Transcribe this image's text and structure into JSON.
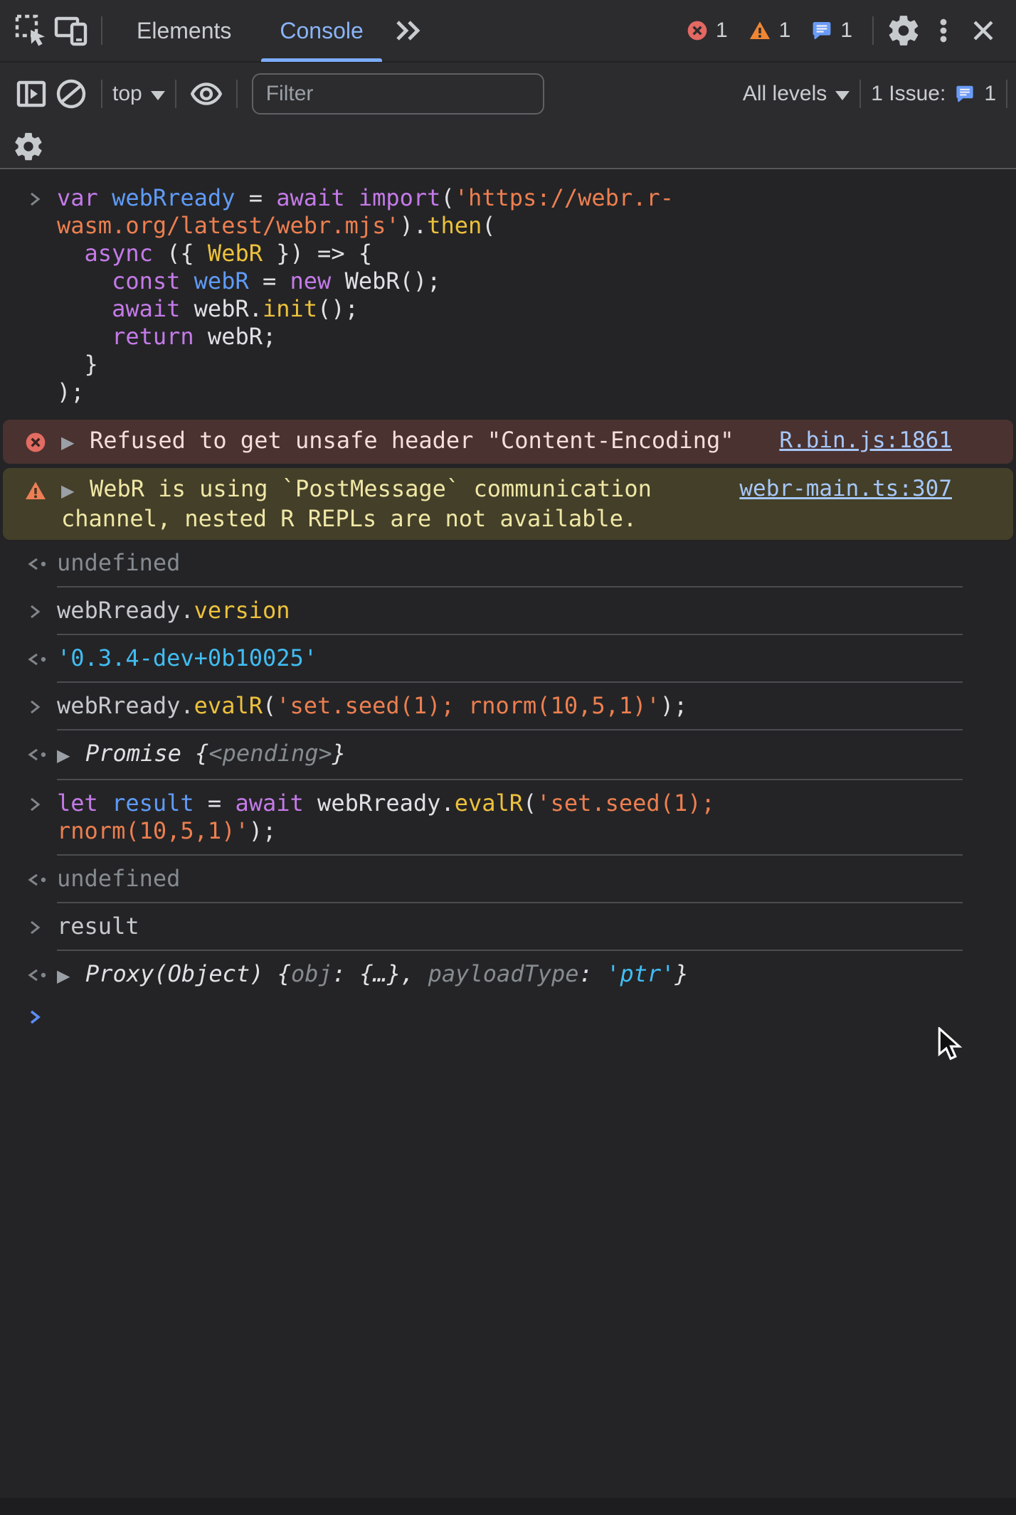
{
  "tabbar": {
    "tabs": [
      {
        "label": "Elements",
        "active": false
      },
      {
        "label": "Console",
        "active": true
      }
    ],
    "badges": {
      "errors": "1",
      "warnings": "1",
      "messages": "1"
    }
  },
  "toolbar": {
    "context_selector": "top",
    "filter_placeholder": "Filter",
    "levels_label": "All levels",
    "issues_label": "1 Issue:",
    "issues_count": "1"
  },
  "icons": {
    "tabbar": [
      "inspect-icon",
      "device-toolbar-icon",
      "more-tabs-icon",
      "error-badge-icon",
      "warning-badge-icon",
      "messages-badge-icon",
      "settings-gear-icon",
      "kebab-menu-icon",
      "close-icon"
    ],
    "toolbar": [
      "sidebar-toggle-icon",
      "clear-console-icon",
      "chevron-down-icon",
      "eye-icon",
      "filter-input",
      "issues-bubble-icon",
      "console-settings-gear-icon"
    ]
  },
  "colors": {
    "accent": "#8ab4f8",
    "tab_underline": "#7cacf8",
    "error_bg": "#4a3230",
    "warning_bg": "#443f28",
    "error_icon": "#e36c62",
    "warning_icon": "#ed7e56",
    "link": "#a6c7fa",
    "keyword": "#c47ae8",
    "variable": "#5f9bf7",
    "function": "#edc13c",
    "string": "#ed7f50",
    "string_value": "#41bdf3",
    "dim": "#868b90",
    "text": "#dfe1e4",
    "prompt": "#5e8df6"
  },
  "console": {
    "entries": [
      {
        "type": "input",
        "separator": false,
        "lines": [
          [
            {
              "c": "kw",
              "t": "var"
            },
            {
              "c": "pl",
              "t": " "
            },
            {
              "c": "vr",
              "t": "webRready"
            },
            {
              "c": "pl",
              "t": " = "
            },
            {
              "c": "kw",
              "t": "await"
            },
            {
              "c": "pl",
              "t": " "
            },
            {
              "c": "kw",
              "t": "import"
            },
            {
              "c": "pl",
              "t": "("
            },
            {
              "c": "str",
              "t": "'https://webr.r-"
            }
          ],
          [
            {
              "c": "str",
              "t": "wasm.org/latest/webr.mjs'"
            },
            {
              "c": "pl",
              "t": ")."
            },
            {
              "c": "fn",
              "t": "then"
            },
            {
              "c": "pl",
              "t": "("
            }
          ],
          [
            {
              "c": "pl",
              "t": "  "
            },
            {
              "c": "kw",
              "t": "async"
            },
            {
              "c": "pl",
              "t": " ({ "
            },
            {
              "c": "fn",
              "t": "WebR"
            },
            {
              "c": "pl",
              "t": " }) => {"
            }
          ],
          [
            {
              "c": "pl",
              "t": "    "
            },
            {
              "c": "kw",
              "t": "const"
            },
            {
              "c": "pl",
              "t": " "
            },
            {
              "c": "vr",
              "t": "webR"
            },
            {
              "c": "pl",
              "t": " = "
            },
            {
              "c": "kw",
              "t": "new"
            },
            {
              "c": "pl",
              "t": " WebR();"
            }
          ],
          [
            {
              "c": "pl",
              "t": "    "
            },
            {
              "c": "kw",
              "t": "await"
            },
            {
              "c": "pl",
              "t": " webR."
            },
            {
              "c": "fn",
              "t": "init"
            },
            {
              "c": "pl",
              "t": "();"
            }
          ],
          [
            {
              "c": "pl",
              "t": "    "
            },
            {
              "c": "kw",
              "t": "return"
            },
            {
              "c": "pl",
              "t": " webR;"
            }
          ],
          [
            {
              "c": "pl",
              "t": "  }"
            }
          ],
          [
            {
              "c": "pl",
              "t": ");"
            }
          ]
        ]
      },
      {
        "type": "error",
        "expandable": true,
        "link": "R.bin.js:1861",
        "separator": false,
        "lines": [
          [
            {
              "c": "errtxt",
              "t": "Refused to get unsafe header \"Content-Encoding\""
            }
          ]
        ]
      },
      {
        "type": "warning",
        "expandable": true,
        "link": "webr-main.ts:307",
        "separator": false,
        "lines": [
          [
            {
              "c": "warntxt",
              "t": "WebR is using `PostMessage` communication"
            }
          ],
          [
            {
              "c": "warntxt",
              "t": "channel, nested R REPLs are not available."
            }
          ]
        ]
      },
      {
        "type": "output",
        "separator": true,
        "lines": [
          [
            {
              "c": "dim",
              "t": "undefined"
            }
          ]
        ]
      },
      {
        "type": "input",
        "separator": true,
        "lines": [
          [
            {
              "c": "pl2",
              "t": "webRready."
            },
            {
              "c": "fn",
              "t": "version"
            }
          ]
        ]
      },
      {
        "type": "output",
        "separator": true,
        "lines": [
          [
            {
              "c": "cyan",
              "t": "'0.3.4-dev+0b10025'"
            }
          ]
        ]
      },
      {
        "type": "input",
        "separator": true,
        "lines": [
          [
            {
              "c": "pl2",
              "t": "webRready."
            },
            {
              "c": "fn",
              "t": "evalR"
            },
            {
              "c": "pl",
              "t": "("
            },
            {
              "c": "str",
              "t": "'set.seed(1); rnorm(10,5,1)'"
            },
            {
              "c": "pl",
              "t": ");"
            }
          ]
        ]
      },
      {
        "type": "output",
        "expandable": true,
        "italic": true,
        "separator": true,
        "lines": [
          [
            {
              "c": "pl",
              "t": "Promise "
            },
            {
              "c": "pl",
              "t": "{"
            },
            {
              "c": "dim",
              "t": "<pending>"
            },
            {
              "c": "pl",
              "t": "}"
            }
          ]
        ]
      },
      {
        "type": "input",
        "separator": true,
        "lines": [
          [
            {
              "c": "kw",
              "t": "let"
            },
            {
              "c": "pl",
              "t": " "
            },
            {
              "c": "vr",
              "t": "result"
            },
            {
              "c": "pl",
              "t": " = "
            },
            {
              "c": "kw",
              "t": "await"
            },
            {
              "c": "pl",
              "t": " webRready."
            },
            {
              "c": "fn",
              "t": "evalR"
            },
            {
              "c": "pl",
              "t": "("
            },
            {
              "c": "str",
              "t": "'set.seed(1);"
            }
          ],
          [
            {
              "c": "str",
              "t": "rnorm(10,5,1)'"
            },
            {
              "c": "pl",
              "t": ");"
            }
          ]
        ]
      },
      {
        "type": "output",
        "separator": true,
        "lines": [
          [
            {
              "c": "dim",
              "t": "undefined"
            }
          ]
        ]
      },
      {
        "type": "input",
        "separator": true,
        "lines": [
          [
            {
              "c": "pl2",
              "t": "result"
            }
          ]
        ]
      },
      {
        "type": "output",
        "expandable": true,
        "italic": true,
        "separator": false,
        "lines": [
          [
            {
              "c": "pl",
              "t": "Proxy(Object) {"
            },
            {
              "c": "dim",
              "t": "obj"
            },
            {
              "c": "pl",
              "t": ": {…}, "
            },
            {
              "c": "dim",
              "t": "payloadType"
            },
            {
              "c": "pl",
              "t": ": "
            },
            {
              "c": "cyan",
              "t": "'ptr'"
            },
            {
              "c": "pl",
              "t": "}"
            }
          ]
        ]
      },
      {
        "type": "prompt"
      }
    ]
  }
}
